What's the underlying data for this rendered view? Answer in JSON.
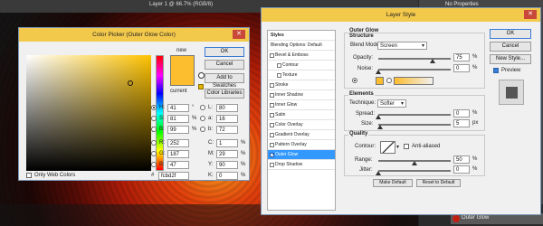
{
  "background": {
    "top_tab": "Layer 1 @ 66.7% (RGB/8)",
    "right_panel_text": "No Properties",
    "layer_row": "Outer Glow"
  },
  "color_picker": {
    "title": "Color Picker (Outer Glow Color)",
    "close": "✕",
    "new_label": "new",
    "current_label": "current",
    "buttons": {
      "ok": "OK",
      "cancel": "Cancel",
      "add_to_swatches": "Add to Swatches",
      "color_libraries": "Color Libraries"
    },
    "color": "#fcbd2f",
    "fields": {
      "h_label": "H:",
      "h_value": "41",
      "h_unit": "°",
      "s_label": "S:",
      "s_value": "81",
      "s_unit": "%",
      "b_label": "B:",
      "b_value": "99",
      "b_unit": "%",
      "r_label": "R:",
      "r_value": "252",
      "g_label": "G:",
      "g_value": "187",
      "bl_label": "B:",
      "bl_value": "47",
      "l_label": "L:",
      "l_value": "80",
      "a_label": "a:",
      "a_value": "16",
      "b2_label": "b:",
      "b2_value": "72",
      "c_label": "C:",
      "c_value": "1",
      "c_unit": "%",
      "m_label": "M:",
      "m_value": "29",
      "m_unit": "%",
      "y_label": "Y:",
      "y_value": "90",
      "y_unit": "%",
      "k_label": "K:",
      "k_value": "0",
      "k_unit": "%",
      "hex_label": "#",
      "hex_value": "fcbd2f"
    },
    "only_web_colors": "Only Web Colors"
  },
  "layer_style": {
    "title": "Layer Style",
    "close": "✕",
    "styles_header": "Styles",
    "styles": [
      {
        "label": "Blending Options: Default",
        "type": "head",
        "checked": false
      },
      {
        "label": "Bevel & Emboss",
        "type": "item",
        "checked": false
      },
      {
        "label": "Contour",
        "type": "sub",
        "checked": false
      },
      {
        "label": "Texture",
        "type": "sub",
        "checked": false
      },
      {
        "label": "Stroke",
        "type": "item",
        "checked": false
      },
      {
        "label": "Inner Shadow",
        "type": "item",
        "checked": false
      },
      {
        "label": "Inner Glow",
        "type": "item",
        "checked": false
      },
      {
        "label": "Satin",
        "type": "item",
        "checked": false
      },
      {
        "label": "Color Overlay",
        "type": "item",
        "checked": false
      },
      {
        "label": "Gradient Overlay",
        "type": "item",
        "checked": false
      },
      {
        "label": "Pattern Overlay",
        "type": "item",
        "checked": false
      },
      {
        "label": "Outer Glow",
        "type": "item",
        "checked": true,
        "selected": true
      },
      {
        "label": "Drop Shadow",
        "type": "item",
        "checked": false
      }
    ],
    "outer_glow_title": "Outer Glow",
    "structure_title": "Structure",
    "blend_mode_label": "Blend Mode:",
    "blend_mode_value": "Screen",
    "opacity_label": "Opacity:",
    "opacity_value": "75",
    "opacity_unit": "%",
    "noise_label": "Noise:",
    "noise_value": "0",
    "noise_unit": "%",
    "elements_title": "Elements",
    "technique_label": "Technique:",
    "technique_value": "Softer",
    "spread_label": "Spread:",
    "spread_value": "0",
    "spread_unit": "%",
    "size_label": "Size:",
    "size_value": "5",
    "size_unit": "px",
    "quality_title": "Quality",
    "contour_label": "Contour:",
    "anti_aliased": "Anti-aliased",
    "range_label": "Range:",
    "range_value": "50",
    "range_unit": "%",
    "jitter_label": "Jitter:",
    "jitter_value": "0",
    "jitter_unit": "%",
    "make_default": "Make Default",
    "reset_default": "Reset to Default",
    "buttons": {
      "ok": "OK",
      "cancel": "Cancel",
      "new_style": "New Style...",
      "preview": "Preview"
    }
  }
}
